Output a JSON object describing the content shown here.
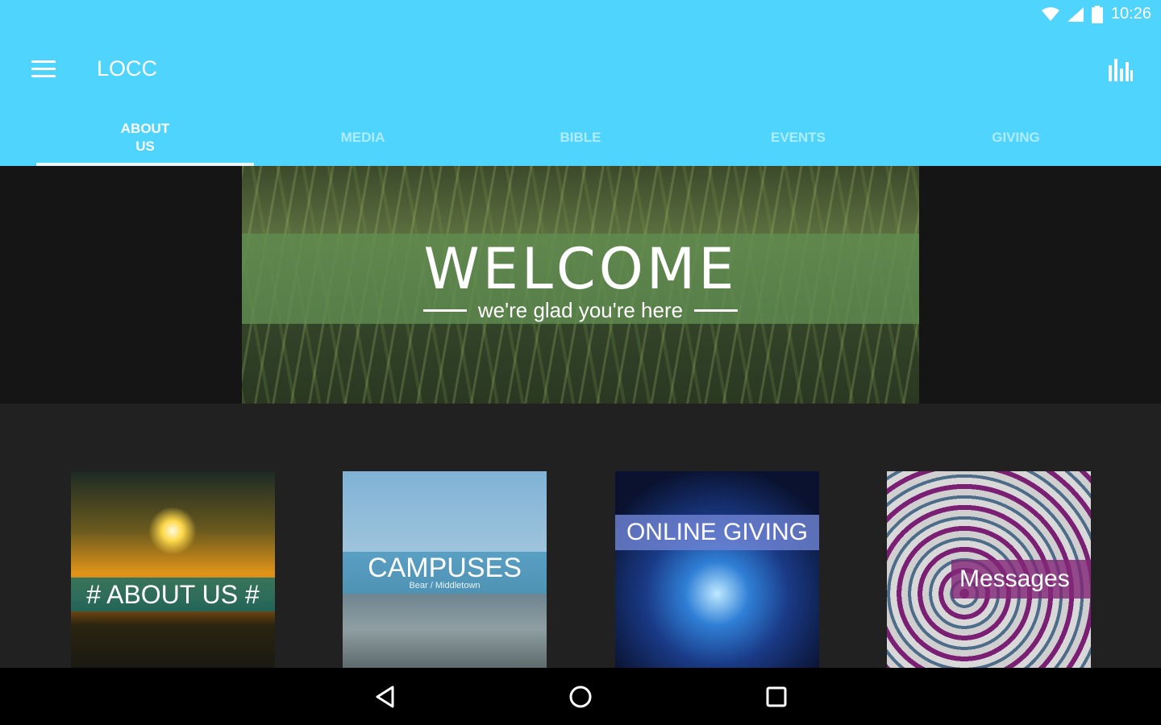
{
  "status": {
    "time": "10:26"
  },
  "toolbar": {
    "title": "LOCC",
    "menu_icon": "hamburger-menu-icon",
    "stats_icon": "bar-chart-icon"
  },
  "tabs": [
    {
      "label": "About Us",
      "active": true
    },
    {
      "label": "Media",
      "active": false
    },
    {
      "label": "Bible",
      "active": false
    },
    {
      "label": "Events",
      "active": false
    },
    {
      "label": "Giving",
      "active": false
    }
  ],
  "hero": {
    "title": "WELCOME",
    "subtitle": "we're glad you're here"
  },
  "cards": {
    "about": {
      "label": "# ABOUT US #"
    },
    "campuses": {
      "label": "CAMPUSES",
      "sub": "Bear / Middletown"
    },
    "giving": {
      "label": "ONLINE GIVING"
    },
    "messages": {
      "label": "Messages"
    }
  },
  "colors": {
    "accent": "#4fd4fd",
    "background": "#212121",
    "navbar": "#000000"
  }
}
